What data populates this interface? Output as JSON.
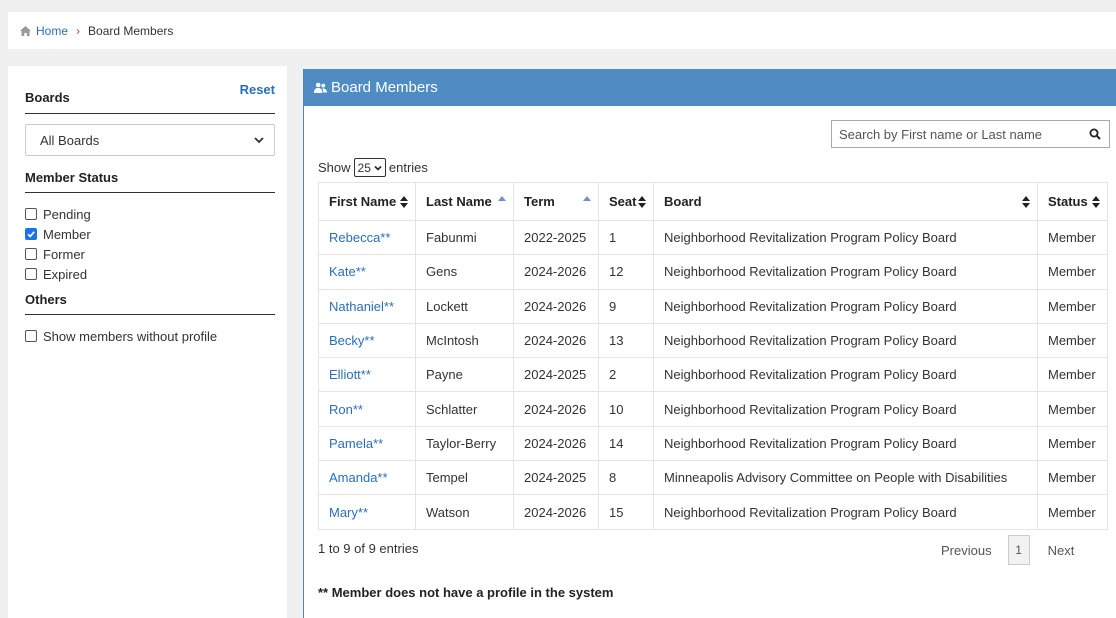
{
  "breadcrumb": {
    "home": "Home",
    "current": "Board Members"
  },
  "sidebar": {
    "boards_title": "Boards",
    "reset_label": "Reset",
    "board_select": "All Boards",
    "member_status_title": "Member Status",
    "statuses": [
      {
        "label": "Pending",
        "checked": false
      },
      {
        "label": "Member",
        "checked": true
      },
      {
        "label": "Former",
        "checked": false
      },
      {
        "label": "Expired",
        "checked": false
      }
    ],
    "others_title": "Others",
    "others": [
      {
        "label": "Show members without profile",
        "checked": false
      }
    ]
  },
  "panel": {
    "title": "Board Members",
    "search_placeholder": "Search by First name or Last name",
    "show_label": "Show",
    "show_value": "25",
    "entries_label": "entries",
    "columns": [
      "First Name",
      "Last Name",
      "Term",
      "Seat",
      "Board",
      "Status"
    ],
    "rows": [
      [
        "Rebecca**",
        "Fabunmi",
        "2022-2025",
        "1",
        "Neighborhood Revitalization Program Policy Board",
        "Member"
      ],
      [
        "Kate**",
        "Gens",
        "2024-2026",
        "12",
        "Neighborhood Revitalization Program Policy Board",
        "Member"
      ],
      [
        "Nathaniel**",
        "Lockett",
        "2024-2026",
        "9",
        "Neighborhood Revitalization Program Policy Board",
        "Member"
      ],
      [
        "Becky**",
        "McIntosh",
        "2024-2026",
        "13",
        "Neighborhood Revitalization Program Policy Board",
        "Member"
      ],
      [
        "Elliott**",
        "Payne",
        "2024-2025",
        "2",
        "Neighborhood Revitalization Program Policy Board",
        "Member"
      ],
      [
        "Ron**",
        "Schlatter",
        "2024-2026",
        "10",
        "Neighborhood Revitalization Program Policy Board",
        "Member"
      ],
      [
        "Pamela**",
        "Taylor-Berry",
        "2024-2026",
        "14",
        "Neighborhood Revitalization Program Policy Board",
        "Member"
      ],
      [
        "Amanda**",
        "Tempel",
        "2024-2025",
        "8",
        "Minneapolis Advisory Committee on People with Disabilities",
        "Member"
      ],
      [
        "Mary**",
        "Watson",
        "2024-2026",
        "15",
        "Neighborhood Revitalization Program Policy Board",
        "Member"
      ]
    ],
    "info": "1 to 9 of 9 entries",
    "pager": {
      "previous": "Previous",
      "page": "1",
      "next": "Next"
    },
    "note": "** Member does not have a profile in the system"
  },
  "colors": {
    "header_blue": "#4f8cc4",
    "link_blue": "#2a6ebb",
    "checkbox_blue": "#1a73e8"
  },
  "icons": {
    "breadcrumb": "home-icon",
    "panel": "users-icon",
    "search": "search-icon"
  }
}
